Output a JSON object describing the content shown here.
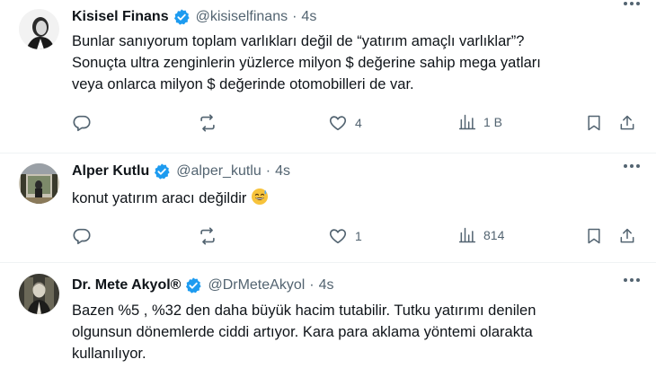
{
  "tweets": [
    {
      "name": "Kisisel Finans",
      "handle": "@kisiselfinans",
      "dot": "·",
      "time": "4s",
      "verified": true,
      "lines": [
        "Bunlar sanıyorum toplam varlıkları değil de “yatırım amaçlı varlıklar”?",
        "Sonuçta ultra zenginlerin yüzlerce milyon $ değerine sahip mega yatları",
        "veya onlarca milyon $ değerinde otomobilleri de var."
      ],
      "likes": "4",
      "views": "1 B"
    },
    {
      "name": "Alper Kutlu",
      "handle": "@alper_kutlu",
      "dot": "·",
      "time": "4s",
      "verified": true,
      "lines": [
        "konut yatırım aracı değildir"
      ],
      "emoji": "sweat-smile-emoji",
      "likes": "1",
      "views": "814"
    },
    {
      "name": "Dr. Mete Akyol®",
      "handle": "@DrMeteAkyol",
      "dot": "·",
      "time": "4s",
      "verified": true,
      "lines": [
        "Bazen %5 , %32 den daha büyük hacim tutabilir. Tutku yatırımı denilen",
        "olgunsun dönemlerde ciddi artıyor. Kara para aklama yöntemi olaraktа",
        "kullanılıyor."
      ]
    }
  ],
  "colors": {
    "verified": "#1d9bf0",
    "muted": "#536471",
    "text": "#0f1419"
  }
}
